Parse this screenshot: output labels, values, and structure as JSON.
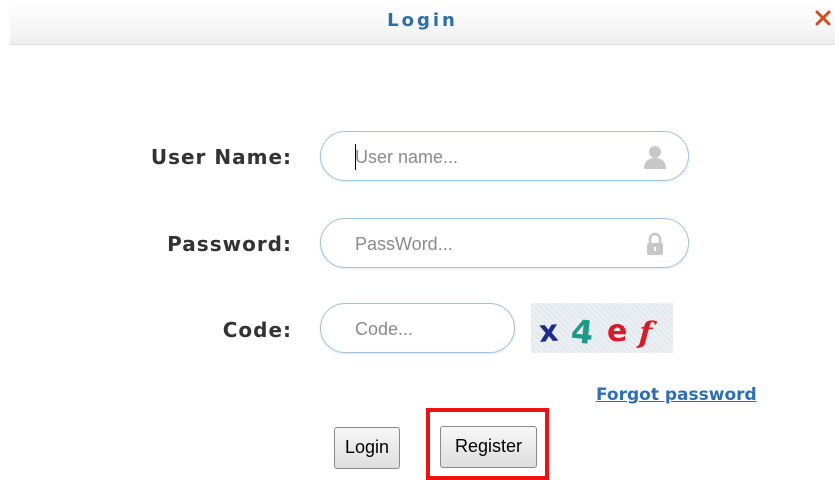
{
  "dialog": {
    "title": "Login",
    "close_icon": "close-x-icon",
    "close_color": "#d64a1f"
  },
  "form": {
    "username": {
      "label": "User Name:",
      "placeholder": "User name...",
      "value": "",
      "icon": "user-icon"
    },
    "password": {
      "label": "Password:",
      "placeholder": "PassWord...",
      "value": "",
      "icon": "lock-icon"
    },
    "code": {
      "label": "Code:",
      "placeholder": "Code...",
      "value": "",
      "captcha_text": "x4ef"
    }
  },
  "links": {
    "forgot_password": "Forgot password"
  },
  "buttons": {
    "login": "Login",
    "register": "Register"
  },
  "colors": {
    "title": "#2f6ea6",
    "field_border": "#9fc3e3",
    "link": "#2d6fb3",
    "highlight": "#ee1111"
  }
}
